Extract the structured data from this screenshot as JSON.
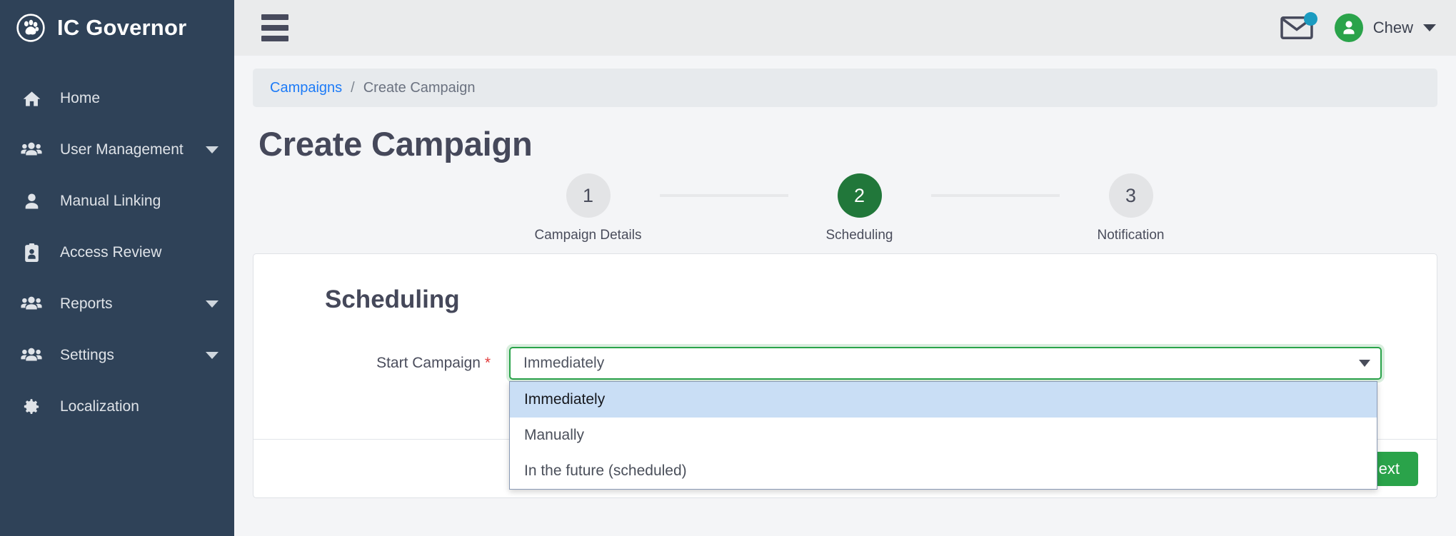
{
  "brand": {
    "title": "IC Governor",
    "logo_icon": "paw-print-circle-icon"
  },
  "sidebar": {
    "items": [
      {
        "label": "Home",
        "icon": "home-icon",
        "has_caret": false
      },
      {
        "label": "User Management",
        "icon": "users-group-icon",
        "has_caret": true
      },
      {
        "label": "Manual Linking",
        "icon": "user-icon",
        "has_caret": false
      },
      {
        "label": "Access Review",
        "icon": "id-badge-icon",
        "has_caret": false
      },
      {
        "label": "Reports",
        "icon": "users-group-icon",
        "has_caret": true
      },
      {
        "label": "Settings",
        "icon": "users-group-icon",
        "has_caret": true
      },
      {
        "label": "Localization",
        "icon": "gear-icon",
        "has_caret": false
      }
    ]
  },
  "topbar": {
    "menu_icon": "hamburger-icon",
    "mail_icon": "envelope-icon",
    "mail_badge": true,
    "avatar_icon": "user-avatar-icon",
    "user_name": "Chew",
    "user_caret_icon": "chevron-down-icon"
  },
  "breadcrumb": {
    "link": "Campaigns",
    "separator": "/",
    "current": "Create Campaign"
  },
  "page": {
    "title": "Create Campaign"
  },
  "stepper": {
    "steps": [
      {
        "number": "1",
        "label": "Campaign Details",
        "active": false
      },
      {
        "number": "2",
        "label": "Scheduling",
        "active": true
      },
      {
        "number": "3",
        "label": "Notification",
        "active": false
      }
    ]
  },
  "form": {
    "section_title": "Scheduling",
    "start_campaign": {
      "label": "Start Campaign",
      "required_marker": "*",
      "selected_value": "Immediately",
      "caret_icon": "chevron-down-icon",
      "options": [
        {
          "label": "Immediately",
          "selected": true
        },
        {
          "label": "Manually",
          "selected": false
        },
        {
          "label": "In the future (scheduled)",
          "selected": false
        }
      ]
    }
  },
  "footer": {
    "next_label": "Next"
  },
  "colors": {
    "sidebar_bg": "#2f4258",
    "topbar_bg": "#eaebec",
    "accent_green": "#2aa34a",
    "step_active_green": "#21773a",
    "link_blue": "#1d7bf7",
    "required_red": "#e23c3c",
    "badge_teal": "#1b9bc0",
    "option_highlight": "#c9def5"
  }
}
